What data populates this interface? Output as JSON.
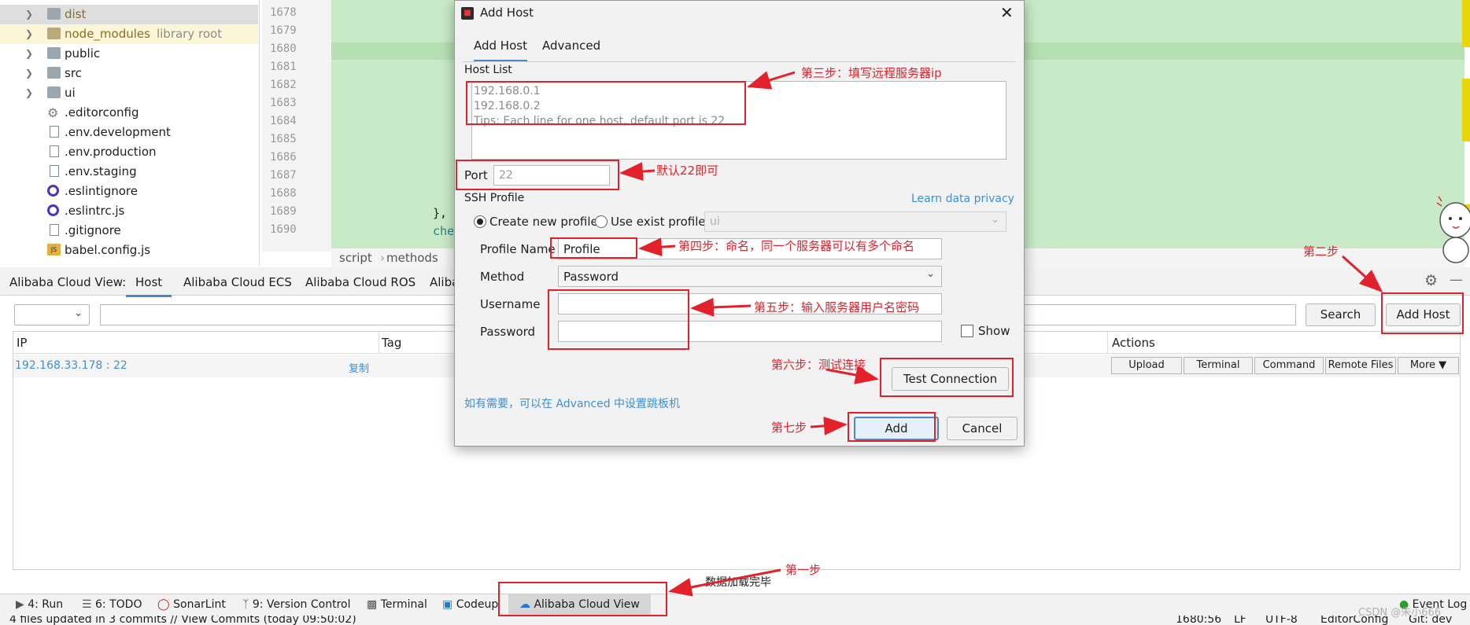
{
  "project_tree": {
    "items": [
      {
        "name": "dist",
        "hint": "",
        "icon": "folder-icon",
        "chevron": true
      },
      {
        "name": "node_modules",
        "hint": "library root",
        "icon": "folder-icon",
        "chevron": true
      },
      {
        "name": "public",
        "hint": "",
        "icon": "folder-icon",
        "chevron": true
      },
      {
        "name": "src",
        "hint": "",
        "icon": "folder-icon",
        "chevron": true
      },
      {
        "name": "ui",
        "hint": "",
        "icon": "folder-icon",
        "chevron": true
      },
      {
        "name": ".editorconfig",
        "hint": "",
        "icon": "gear-icon",
        "chevron": false
      },
      {
        "name": ".env.development",
        "hint": "",
        "icon": "file-icon",
        "chevron": false
      },
      {
        "name": ".env.production",
        "hint": "",
        "icon": "file-icon",
        "chevron": false
      },
      {
        "name": ".env.staging",
        "hint": "",
        "icon": "file-icon",
        "chevron": false
      },
      {
        "name": ".eslintignore",
        "hint": "",
        "icon": "eslint-icon",
        "chevron": false
      },
      {
        "name": ".eslintrc.js",
        "hint": "",
        "icon": "eslint-icon",
        "chevron": false
      },
      {
        "name": ".gitignore",
        "hint": "",
        "icon": "file-icon",
        "chevron": false
      },
      {
        "name": "babel.config.js",
        "hint": "",
        "icon": "js-icon",
        "chevron": false
      }
    ]
  },
  "editor": {
    "line_numbers": [
      "1678",
      "1679",
      "1680",
      "1681",
      "1682",
      "1683",
      "1684",
      "1685",
      "1686",
      "1687",
      "1688",
      "1689",
      "1690"
    ],
    "code_lines": {
      "l1689": "},",
      "l1690": "che"
    },
    "breadcrumb": [
      "script",
      "methods"
    ]
  },
  "tool_window": {
    "title": "Alibaba Cloud View:",
    "tabs": [
      "Host",
      "Alibaba Cloud ECS",
      "Alibaba Cloud ROS",
      "Aliba"
    ]
  },
  "host_panel": {
    "search_label": "Search",
    "add_host_label": "Add Host",
    "columns": {
      "ip": "IP",
      "tag": "Tag",
      "actions": "Actions"
    },
    "rows": [
      {
        "ip": "192.168.33.178 : 22",
        "copy": "复制"
      }
    ],
    "actions": [
      "Upload",
      "Terminal",
      "Command",
      "Remote Files",
      "More ▼"
    ]
  },
  "dialog": {
    "title": "Add Host",
    "tabs": [
      "Add Host",
      "Advanced"
    ],
    "host_list_label": "Host List",
    "host_list_lines": [
      "192.168.0.1",
      "192.168.0.2",
      "Tips: Each line for one host, default port is 22"
    ],
    "port_label": "Port",
    "port_placeholder": "22",
    "ssh_profile_label": "SSH Profile",
    "learn_privacy": "Learn data privacy",
    "create_profile": "Create new profile",
    "use_exist_profile": "Use exist profile",
    "exist_profile_value": "ui",
    "profile_name_label": "Profile Name",
    "profile_name_value": "Profile",
    "method_label": "Method",
    "method_value": "Password",
    "username_label": "Username",
    "password_label": "Password",
    "show_label": "Show",
    "jump_hint": "如有需要，可以在 Advanced 中设置跳板机",
    "test_connection": "Test Connection",
    "add": "Add",
    "cancel": "Cancel"
  },
  "annotations": {
    "step1": "第一步",
    "step2": "第二步",
    "step3": "第三步：填写远程服务器ip",
    "step_port": "默认22即可",
    "step4": "第四步：命名，同一个服务器可以有多个命名",
    "step5": "第五步：输入服务器用户名密码",
    "step6": "第六步：测试连接",
    "step7": "第七步"
  },
  "loading_text": "数据加载完毕",
  "bottom_tabs": [
    "4: Run",
    "6: TODO",
    "SonarLint",
    "9: Version Control",
    "Terminal",
    "Codeup",
    "Alibaba Cloud View"
  ],
  "event_log": "Event Log",
  "status": {
    "left": "4 files updated in 3 commits // View Commits (today 09:50:02)",
    "position": "1680:56",
    "line_sep": "LF",
    "encoding": "UTF-8",
    "config": "EditorConfig",
    "git": "Git: dev"
  },
  "watermark": "CSDN @朱小666",
  "colors": {
    "accent": "#4a88c7",
    "annotation": "#e3212a",
    "link": "#3d8fd6",
    "editor_bg": "#c8eac6"
  }
}
